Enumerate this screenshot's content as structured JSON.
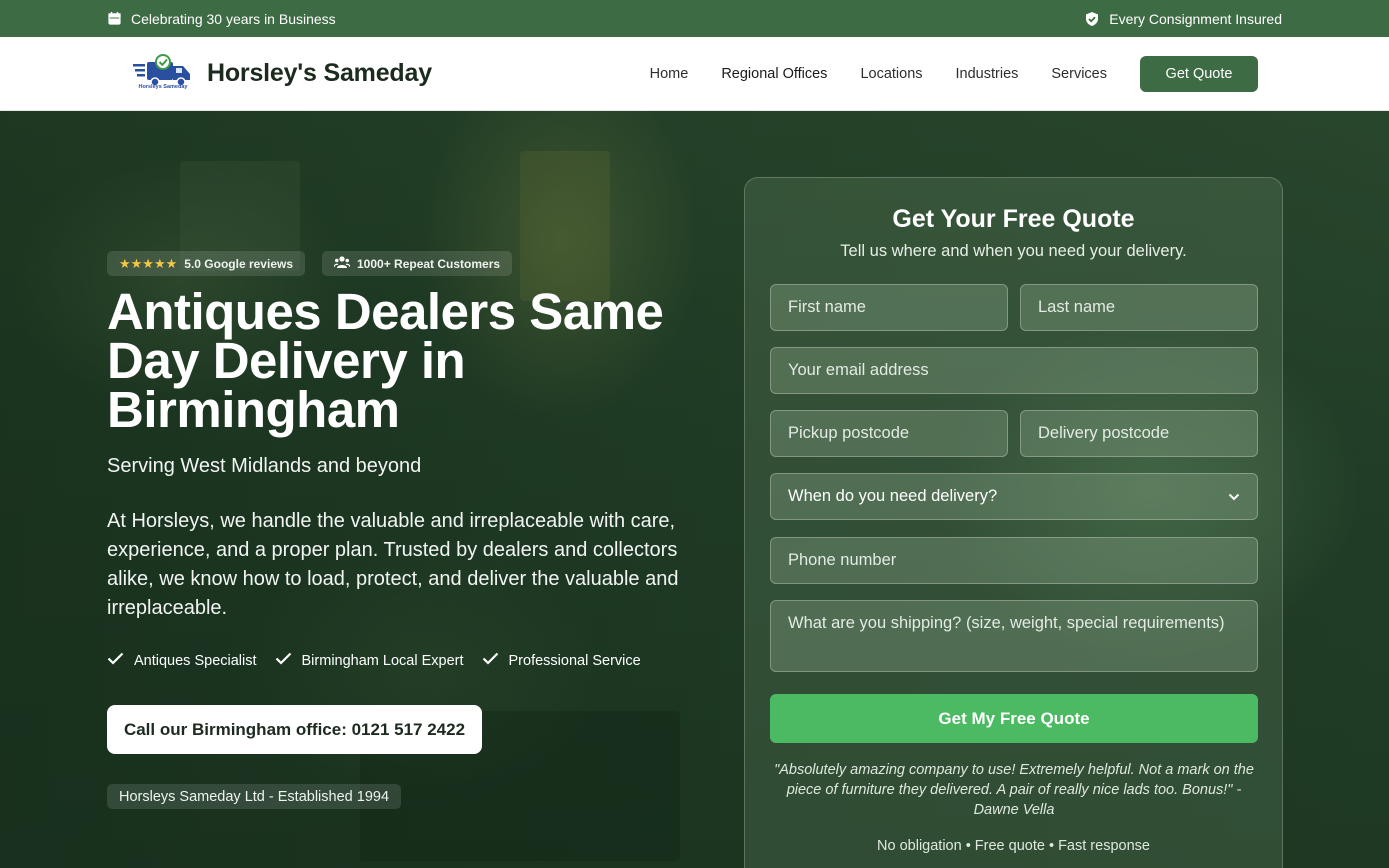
{
  "topbar": {
    "left_text": "Celebrating 30 years in Business",
    "left_icon": "calendar-icon",
    "right_text": "Every Consignment Insured",
    "right_icon": "shield-check-icon"
  },
  "header": {
    "logo_text": "Horsleys Sameday",
    "brand_name": "Horsley's Sameday",
    "nav": [
      "Home",
      "Regional Offices",
      "Locations",
      "Industries",
      "Services"
    ],
    "cta": "Get Quote"
  },
  "hero": {
    "rating_text": "5.0 Google reviews",
    "rating_stars": 5,
    "customers_text": "1000+ Repeat Customers",
    "title": "Antiques Dealers Same Day Delivery in Birmingham",
    "subtitle": "Serving West Midlands and beyond",
    "description": "At Horsleys, we handle the valuable and irreplaceable with care, experience, and a proper plan. Trusted by dealers and collectors alike, we know how to load, protect, and deliver the valuable and irreplaceable.",
    "features": [
      "Antiques Specialist",
      "Birmingham Local Expert",
      "Professional Service"
    ],
    "call_button": "Call our Birmingham office: 0121 517 2422",
    "established": "Horsleys Sameday Ltd - Established 1994"
  },
  "form": {
    "title": "Get Your Free Quote",
    "subtitle": "Tell us where and when you need your delivery.",
    "first_name_placeholder": "First name",
    "last_name_placeholder": "Last name",
    "email_placeholder": "Your email address",
    "pickup_placeholder": "Pickup postcode",
    "delivery_placeholder": "Delivery postcode",
    "when_select": "When do you need delivery?",
    "phone_placeholder": "Phone number",
    "shipping_placeholder": "What are you shipping? (size, weight, special requirements)",
    "submit": "Get My Free Quote",
    "testimonial": "\"Absolutely amazing company to use! Extremely helpful. Not a mark on the piece of furniture they delivered. A pair of really nice lads too. Bonus!\" - Dawne Vella",
    "footer": "No obligation • Free quote • Fast response"
  },
  "colors": {
    "brand_green": "#3d6b43",
    "submit_green": "#4cb963",
    "star_yellow": "#f3c743"
  }
}
